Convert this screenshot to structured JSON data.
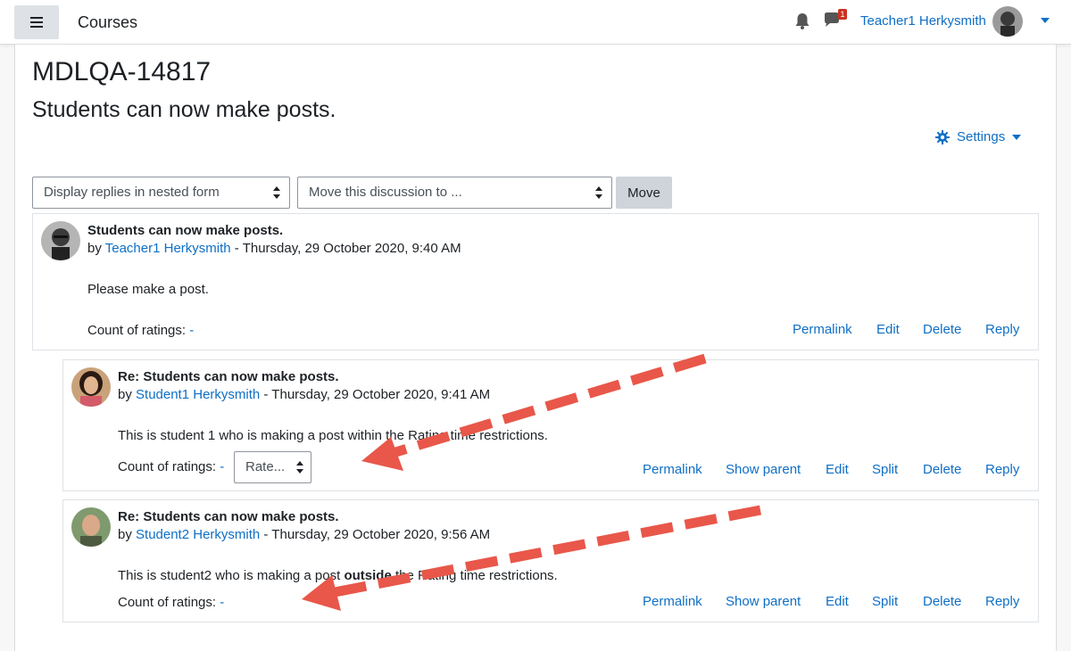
{
  "navbar": {
    "brand": "Courses",
    "notification_count": "1",
    "user_name": "Teacher1 Herkysmith"
  },
  "page": {
    "course_title": "MDLQA-14817",
    "discussion_title": "Students can now make posts.",
    "settings_label": "Settings"
  },
  "controls": {
    "display_mode": "Display replies in nested form",
    "move_select": "Move this discussion to ...",
    "move_button": "Move"
  },
  "posts": [
    {
      "subject": "Students can now make posts.",
      "by": "by",
      "author": "Teacher1 Herkysmith",
      "date": " - Thursday, 29 October 2020, 9:40 AM",
      "body": "Please make a post.",
      "ratings_label": "Count of ratings:",
      "ratings_value": "-",
      "actions": [
        "Permalink",
        "Edit",
        "Delete",
        "Reply"
      ]
    },
    {
      "subject": "Re: Students can now make posts.",
      "by": "by",
      "author": "Student1 Herkysmith",
      "date": " - Thursday, 29 October 2020, 9:41 AM",
      "body": "This is student 1 who is making a post within the Rating time restrictions.",
      "ratings_label": "Count of ratings:",
      "ratings_value": "-",
      "rate_select": "Rate...",
      "actions": [
        "Permalink",
        "Show parent",
        "Edit",
        "Split",
        "Delete",
        "Reply"
      ]
    },
    {
      "subject": "Re: Students can now make posts.",
      "by": "by",
      "author": "Student2 Herkysmith",
      "date": " - Thursday, 29 October 2020, 9:56 AM",
      "body_before": "This is student2 who is making a post ",
      "body_bold": "outside",
      "body_after": " the Rating time restrictions.",
      "ratings_label": "Count of ratings:",
      "ratings_value": "-",
      "actions": [
        "Permalink",
        "Show parent",
        "Edit",
        "Split",
        "Delete",
        "Reply"
      ]
    }
  ],
  "icons": {
    "menu": "hamburger-icon",
    "bell": "bell-icon",
    "chat": "chat-icon",
    "settings": "gear-icon",
    "caret": "caret-down-icon"
  },
  "colors": {
    "link": "#0f6fc5",
    "annotation_arrow": "#e8574a",
    "badge": "#ca3120"
  }
}
